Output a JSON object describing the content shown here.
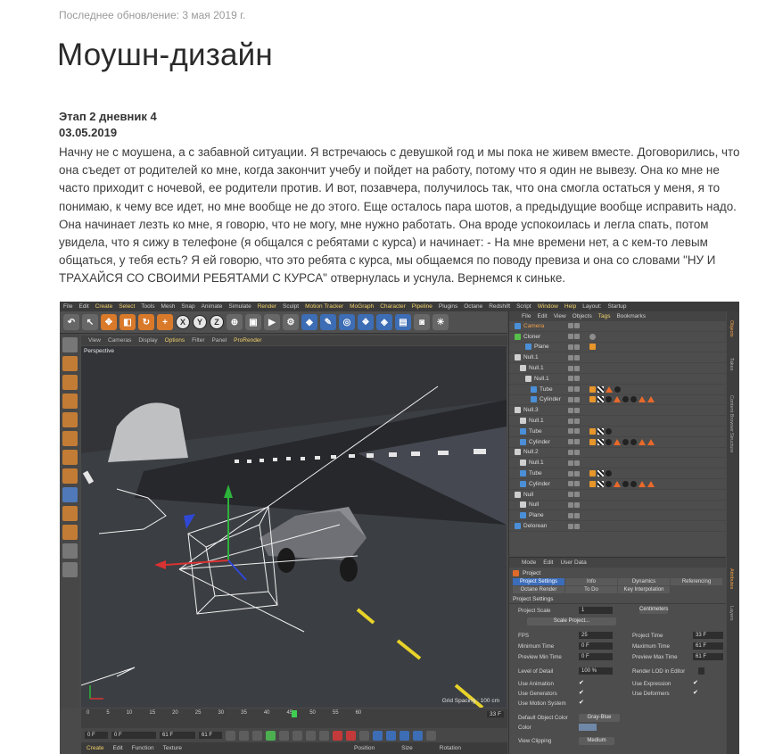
{
  "page": {
    "updated": "Последнее обновление: 3 мая 2019 г.",
    "title": "Моушн-дизайн"
  },
  "entry": {
    "heading": "Этап 2 дневник 4",
    "date": "03.05.2019",
    "body": "Начну не с моушена, а с забавной ситуации. Я встречаюсь с девушкой год и мы пока не живем вместе. Договорились, что она съедет от родителей ко мне, когда закончит учебу и пойдет на работу, потому что я один не вывезу. Она ко мне не часто приходит с ночевой, ее родители против. И вот, позавчера, получилось так, что она смогла остаться у меня, я то понимаю, к чему все идет, но мне вообще не до этого. Еще осталось пара шотов, а предыдущие вообще исправить надо. Она начинает лезть ко мне, я говорю, что не могу, мне нужно работать. Она вроде успокоилась и легла спать, потом увидела, что я сижу в телефоне (я общался с ребятами с курса) и начинает: - На мне времени нет, а с кем-то левым общаться, у тебя есть? Я ей говорю, что это ребята с курса, мы общаемся по поводу превиза и она со словами \"НУ И ТРАХАЙСЯ СО СВОИМИ РЕБЯТАМИ С КУРСА\" отвернулась и уснула. Вернемся к синьке."
  },
  "app": {
    "menu": [
      "File",
      "Edit",
      "Create",
      "Select",
      "Tools",
      "Mesh",
      "Snap",
      "Animate",
      "Simulate",
      "Render",
      "Sculpt",
      "Motion Tracker",
      "MoGraph",
      "Character",
      "Pipeline",
      "Plugins",
      "Octane",
      "Redshift",
      "Script",
      "Window",
      "Help",
      "Layout:",
      "Startup"
    ],
    "viewport_menu": [
      "View",
      "Cameras",
      "Display",
      "Options",
      "Filter",
      "Panel",
      "ProRender"
    ],
    "viewport_label": "Perspective",
    "grid_spacing": "Grid Spacing : 100 cm",
    "timeline_ticks": [
      "0",
      "5",
      "10",
      "15",
      "20",
      "25",
      "30",
      "35",
      "40",
      "45",
      "50",
      "55",
      "60"
    ],
    "current_frame": "33 F",
    "end_frame": "33 F",
    "transport": {
      "start": "0 F",
      "min": "0 F",
      "max": "61 F",
      "end": "61 F"
    },
    "material_menu": [
      "Create",
      "Edit",
      "Function",
      "Texture"
    ],
    "coord_headers": [
      "Position",
      "Size",
      "Rotation"
    ],
    "object_manager": {
      "menu": [
        "File",
        "Edit",
        "View",
        "Objects",
        "Tags",
        "Bookmarks"
      ],
      "objects": [
        {
          "name": "Camera",
          "indent": 0,
          "sel": true,
          "icon": "#4a8fd8"
        },
        {
          "name": "Cloner",
          "indent": 0,
          "icon": "#56c04a"
        },
        {
          "name": "Plane",
          "indent": 2,
          "icon": "#4a8fd8"
        },
        {
          "name": "Null.1",
          "indent": 0,
          "icon": "#cfcfcf"
        },
        {
          "name": "Null.1",
          "indent": 1,
          "icon": "#cfcfcf"
        },
        {
          "name": "Null.1",
          "indent": 2,
          "icon": "#cfcfcf"
        },
        {
          "name": "Tube",
          "indent": 3,
          "icon": "#4a8fd8"
        },
        {
          "name": "Cylinder",
          "indent": 3,
          "icon": "#4a8fd8"
        },
        {
          "name": "Null.3",
          "indent": 0,
          "icon": "#cfcfcf"
        },
        {
          "name": "Null.1",
          "indent": 1,
          "icon": "#cfcfcf"
        },
        {
          "name": "Tube",
          "indent": 1,
          "icon": "#4a8fd8"
        },
        {
          "name": "Cylinder",
          "indent": 1,
          "icon": "#4a8fd8"
        },
        {
          "name": "Null.2",
          "indent": 0,
          "icon": "#cfcfcf"
        },
        {
          "name": "Null.1",
          "indent": 1,
          "icon": "#cfcfcf"
        },
        {
          "name": "Tube",
          "indent": 1,
          "icon": "#4a8fd8"
        },
        {
          "name": "Cylinder",
          "indent": 1,
          "icon": "#4a8fd8"
        },
        {
          "name": "Null",
          "indent": 0,
          "icon": "#cfcfcf"
        },
        {
          "name": "Null",
          "indent": 1,
          "icon": "#cfcfcf"
        },
        {
          "name": "Plane",
          "indent": 1,
          "icon": "#4a8fd8"
        },
        {
          "name": "Delorean",
          "indent": 0,
          "icon": "#4a8fd8"
        }
      ]
    },
    "attributes": {
      "menu": [
        "Mode",
        "Edit",
        "User Data"
      ],
      "title": "Project",
      "tabs": [
        "Project Settings",
        "Info",
        "Dynamics",
        "Referencing",
        "Octane Render",
        "To Do",
        "Key Interpolation"
      ],
      "section": "Project Settings",
      "project_scale_label": "Project Scale",
      "project_scale_value": "1",
      "project_scale_unit": "Centimeters",
      "scale_button": "Scale Project...",
      "fps_label": "FPS",
      "fps": "25",
      "project_time_label": "Project Time",
      "project_time": "33 F",
      "min_time_label": "Minimum Time",
      "min_time": "0 F",
      "max_time_label": "Maximum Time",
      "max_time": "61 F",
      "prev_min_label": "Preview Min Time",
      "prev_min": "0 F",
      "prev_max_label": "Preview Max Time",
      "prev_max": "61 F",
      "lod_label": "Level of Detail",
      "lod": "100 %",
      "render_lod_label": "Render LOD in Editor",
      "use_animation": "Use Animation",
      "use_expression": "Use Expression",
      "use_generators": "Use Generators",
      "use_deformers": "Use Deformers",
      "use_motion": "Use Motion System",
      "default_color_label": "Default Object Color",
      "default_color": "Gray-Blue",
      "color_label": "Color",
      "view_clipping_label": "View Clipping",
      "view_clipping": "Medium"
    },
    "side_tabs": [
      "Objects",
      "Takes",
      "Content Browser",
      "Structure",
      "Attributes",
      "Layers"
    ]
  }
}
